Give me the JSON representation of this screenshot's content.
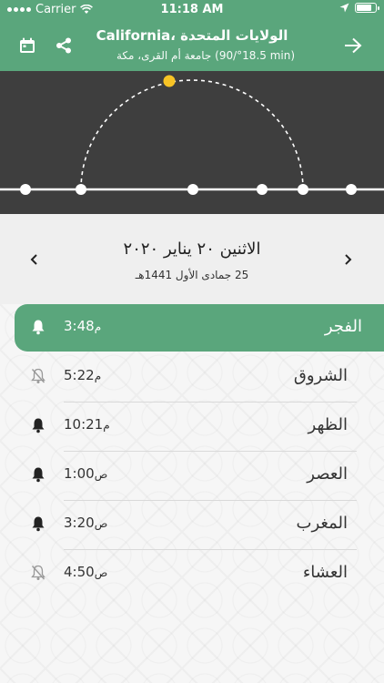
{
  "status_bar": {
    "carrier": "Carrier",
    "time": "11:18 AM"
  },
  "header": {
    "title": "California، الولايات المتحدة",
    "subtitle": "جامعة أم القرى، مكة (18.5°/90 min)",
    "icons": [
      "calendar-icon",
      "share-icon",
      "arrow-right-icon"
    ]
  },
  "colors": {
    "primary": "#5aa67c",
    "sun_panel_bg": "#3e3e3e",
    "sun": "#f7c325",
    "date_bar_bg": "#efefef"
  },
  "date_bar": {
    "gregorian": "الاثنين ٢٠ يناير ٢٠٢٠",
    "hijri": "25 جمادى الأول 1441هـ",
    "prev_icon": "chevron-left-icon",
    "next_icon": "chevron-right-icon"
  },
  "prayers": [
    {
      "name": "الفجر",
      "time": "3:48",
      "suffix": "م",
      "bell": "on",
      "active": true
    },
    {
      "name": "الشروق",
      "time": "5:22",
      "suffix": "م",
      "bell": "off",
      "active": false
    },
    {
      "name": "الظهر",
      "time": "10:21",
      "suffix": "م",
      "bell": "on",
      "active": false
    },
    {
      "name": "العصر",
      "time": "1:00",
      "suffix": "ص",
      "bell": "on",
      "active": false
    },
    {
      "name": "المغرب",
      "time": "3:20",
      "suffix": "ص",
      "bell": "on",
      "active": false
    },
    {
      "name": "العشاء",
      "time": "4:50",
      "suffix": "ص",
      "bell": "off",
      "active": false
    }
  ]
}
